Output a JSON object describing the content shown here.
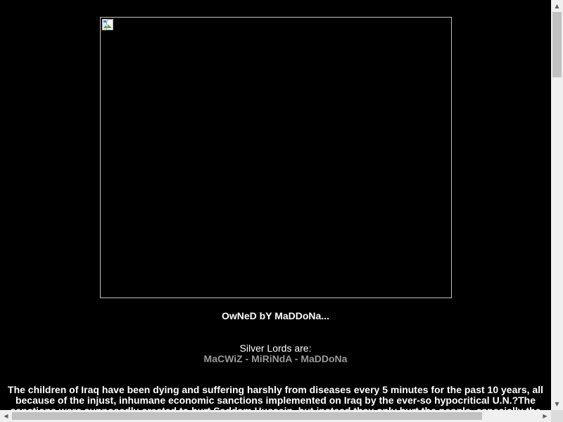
{
  "page": {
    "owned_text": "OwNeD bY MaDDoNa...",
    "silver_lords_title": "Silver Lords are:",
    "silver_lords_members": "MaCWiZ - MiRiNdA - MaDDoNa",
    "message": "The children of Iraq have been dying and suffering harshly from diseases every 5 minutes for the past 10 years, all because of the injust, inhumane economic sanctions implemented on Iraq by the ever-so hypocritical U.N.?The sanctions were supposedly created to hurt Saddam Hussein, but instead they only hurt the people, especially the children."
  },
  "icons": {
    "broken_image": "broken-image-icon",
    "scroll_up": "arrow-up-icon",
    "scroll_down": "arrow-down-icon",
    "scroll_left": "arrow-left-icon",
    "scroll_right": "arrow-right-icon"
  },
  "colors": {
    "background": "#000000",
    "text": "#ffffff",
    "members_text": "#999999",
    "image_border": "#c0c0c0",
    "scrollbar_track": "#f0f0f0",
    "scrollbar_thumb": "#c1c1c1"
  }
}
